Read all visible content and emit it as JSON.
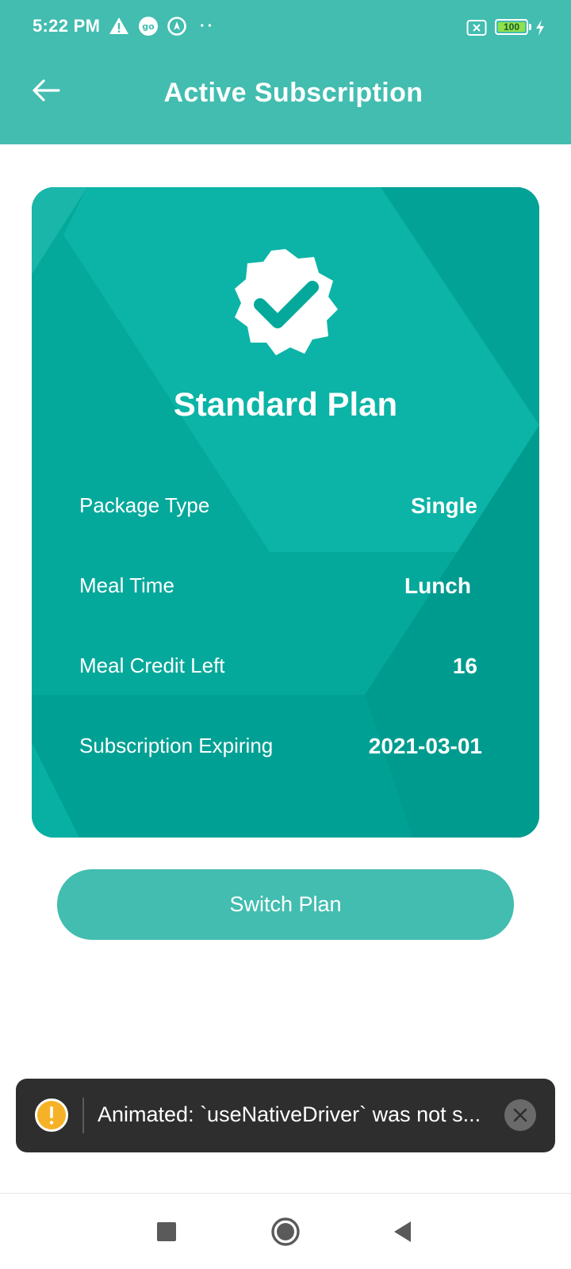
{
  "status_bar": {
    "time": "5:22 PM",
    "dots": "··",
    "battery_level": "100",
    "icons": [
      "warning-icon",
      "go-icon",
      "navigation-icon",
      "sim-off-icon",
      "battery-icon",
      "charging-icon"
    ]
  },
  "header": {
    "title": "Active Subscription",
    "back_icon": "arrow-left-icon"
  },
  "card": {
    "badge_icon": "verified-check-badge-icon",
    "plan_name": "Standard Plan",
    "rows": [
      {
        "label": "Package Type",
        "value": "Single"
      },
      {
        "label": "Meal Time",
        "value": "Lunch"
      },
      {
        "label": "Meal Credit Left",
        "value": "16"
      },
      {
        "label": "Subscription Expiring",
        "value": "2021-03-01"
      }
    ]
  },
  "actions": {
    "switch_plan_label": "Switch Plan"
  },
  "toast": {
    "icon": "warning-circle-icon",
    "message": "Animated: `useNativeDriver` was not s...",
    "close_icon": "close-icon"
  },
  "navigation_bar": {
    "buttons": [
      "recents-square-icon",
      "home-circle-icon",
      "back-triangle-icon"
    ]
  },
  "colors": {
    "header": "#42bdb0",
    "card": "#05a99b",
    "button": "#42bdb0",
    "toast": "#2e2e2e",
    "toast_warning": "#f6b226"
  }
}
